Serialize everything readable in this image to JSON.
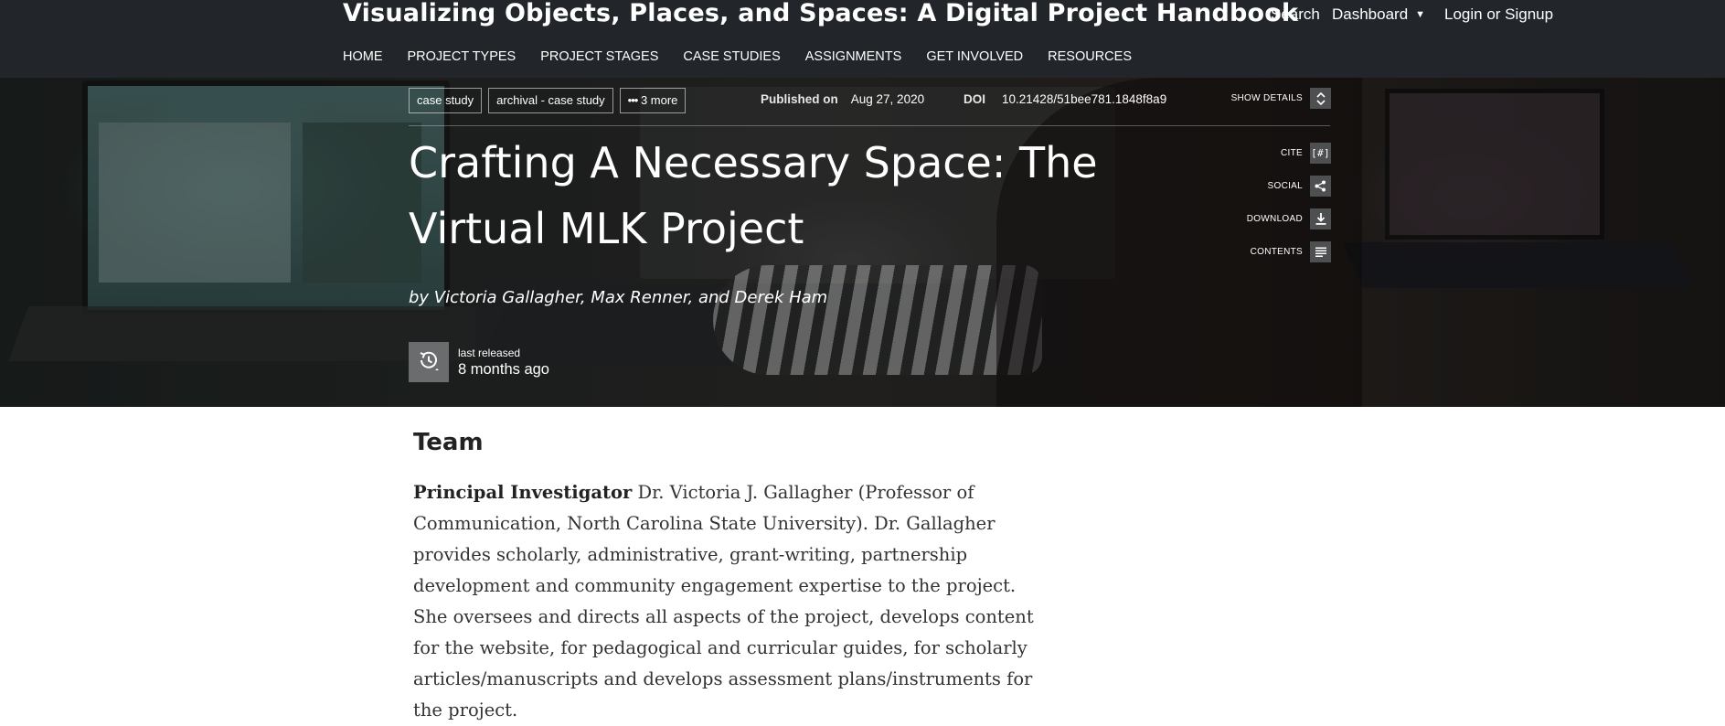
{
  "site": {
    "title": "Visualizing Objects, Places, and Spaces: A Digital Project Handbook",
    "search": "Search",
    "dashboard": "Dashboard",
    "login": "Login or Signup",
    "menu": [
      "HOME",
      "PROJECT TYPES",
      "PROJECT STAGES",
      "CASE STUDIES",
      "ASSIGNMENTS",
      "GET INVOLVED",
      "RESOURCES"
    ]
  },
  "pub": {
    "tags": [
      "case study",
      "archival - case study",
      "3 more"
    ],
    "published_label": "Published on",
    "published_date": "Aug 27, 2020",
    "doi_label": "DOI",
    "doi_value": "10.21428/51bee781.1848f8a9",
    "show_details": "SHOW DETAILS",
    "actions": {
      "cite": "CITE",
      "social": "SOCIAL",
      "download": "DOWNLOAD",
      "contents": "CONTENTS"
    },
    "title": "Crafting A Necessary Space: The Virtual MLK Project",
    "byline": "by Victoria Gallagher, Max Renner, and Derek Ham",
    "release_label": "last released",
    "release_value": "8 months ago"
  },
  "content": {
    "heading": "Team",
    "lead": "Principal Investigator",
    "text": " Dr. Victoria J. Gallagher (Professor of Communication, North Carolina State University). Dr. Gallagher provides scholarly, administrative, grant-writing, partnership development and community engagement expertise to the project. She oversees and directs all aspects of the project, develops content for the website, for pedagogical and curricular guides, for scholarly articles/manuscripts and develops assessment plans/instruments for the project."
  },
  "icons": {
    "more": "ellipsis-icon",
    "details": "chevron-up-down-icon",
    "cite": "cite-brackets-icon",
    "social": "share-icon",
    "download": "download-icon",
    "contents": "list-icon",
    "release": "history-icon"
  }
}
